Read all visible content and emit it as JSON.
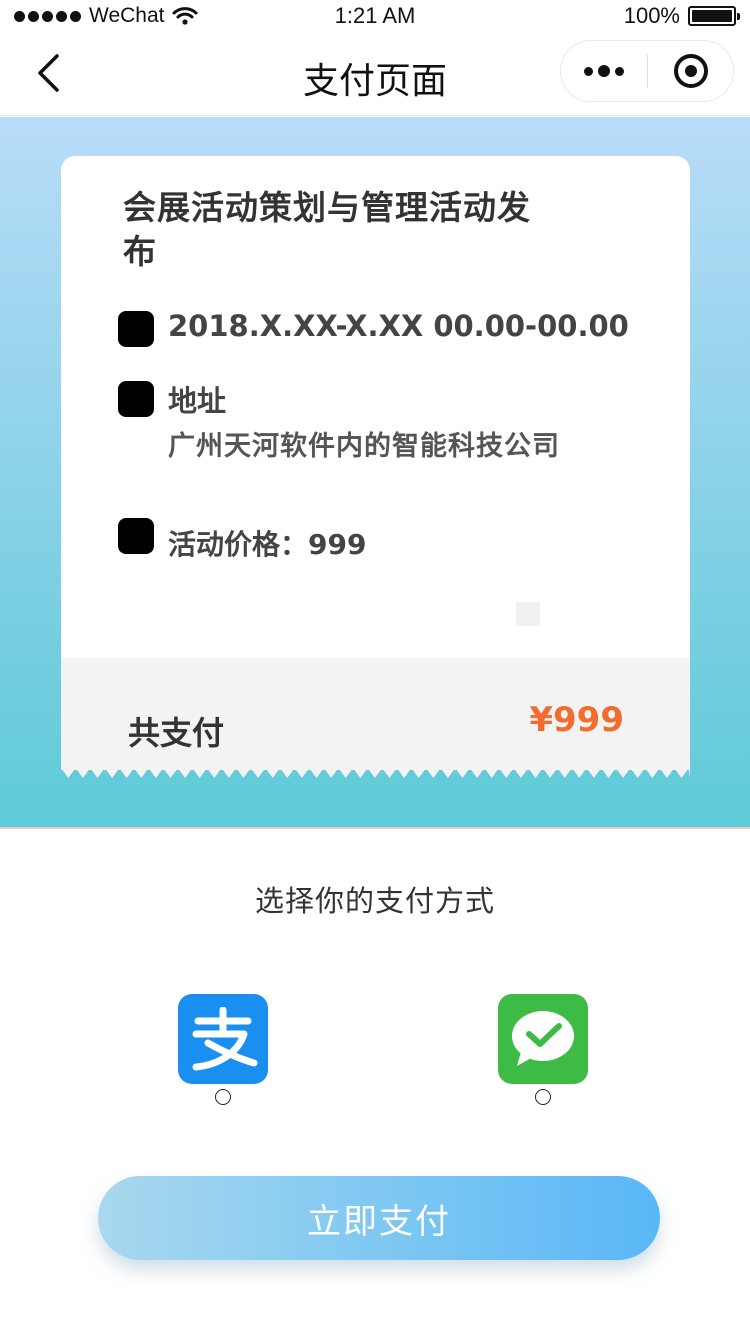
{
  "status_bar": {
    "carrier": "WeChat",
    "time": "1:21 AM",
    "battery": "100%",
    "battery_level": 1.0
  },
  "nav": {
    "title": "支付页面",
    "back_icon": "chevron-left-icon",
    "more_icon": "more-dots-icon",
    "close_icon": "target-circle-icon"
  },
  "event": {
    "title": "会展活动策划与管理活动发布",
    "datetime": "2018.X.XX-X.XX 00.00-00.00",
    "address_label": "地址",
    "address": "广州天河软件内的智能科技公司",
    "price_label": "活动价格：999"
  },
  "summary": {
    "total_label": "共支付",
    "total_amount": "¥999"
  },
  "payment": {
    "heading": "选择你的支付方式",
    "methods": [
      {
        "icon": "alipay-icon",
        "selected": false
      },
      {
        "icon": "wechat-pay-icon",
        "selected": false
      }
    ],
    "pay_button": "立即支付"
  },
  "colors": {
    "amount": "#f36b2d",
    "gradient_top": "#b9dcf9",
    "gradient_bottom": "#5ecad7",
    "alipay": "#1a8ff2",
    "wechat": "#3dbb44",
    "button_start": "#a9d8ee",
    "button_end": "#5ab7f7"
  }
}
